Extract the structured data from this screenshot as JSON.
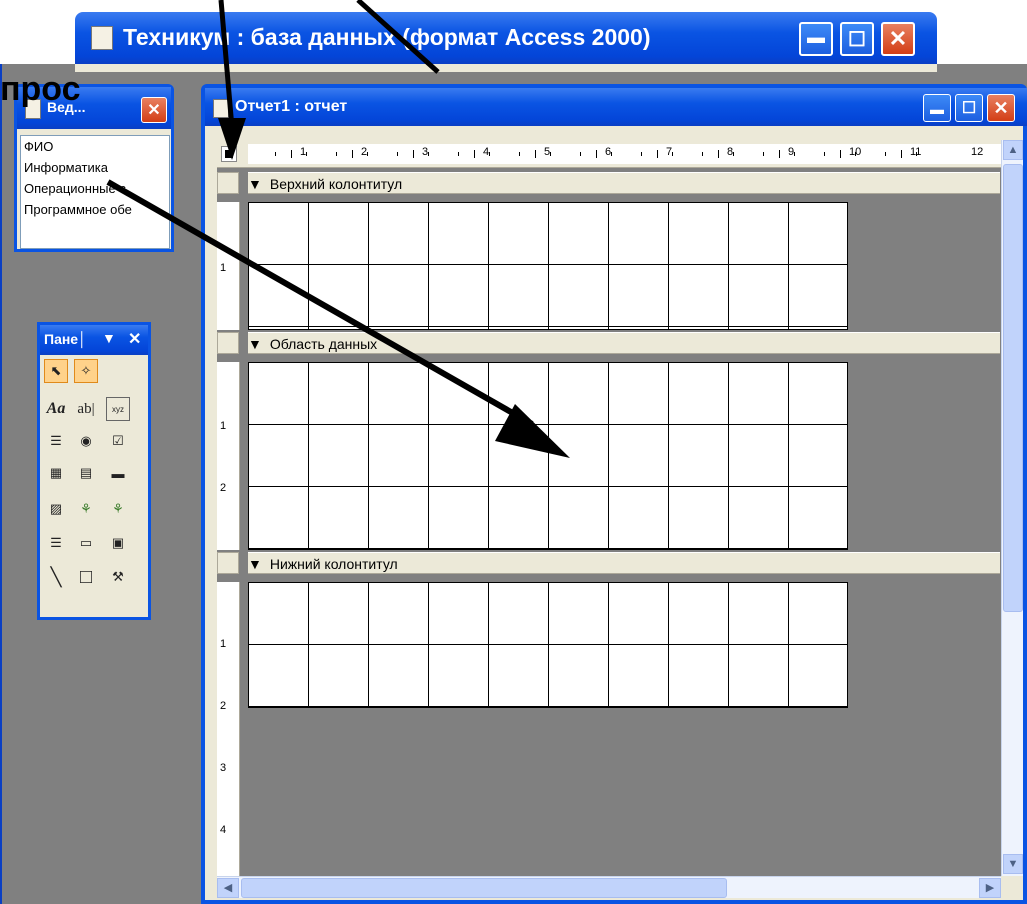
{
  "overlay": {
    "fragment": "прос"
  },
  "main_window": {
    "title": "Техникум : база данных (формат Access 2000)"
  },
  "field_list": {
    "title": "Вед...",
    "fields": [
      "ФИО",
      "Информатика",
      "Операционные с",
      "Программное обе"
    ]
  },
  "toolbox": {
    "title": "Пане│"
  },
  "report": {
    "title": "Отчет1 : отчет",
    "ruler_numbers": [
      "1",
      "2",
      "3",
      "4",
      "5",
      "6",
      "7",
      "8",
      "9",
      "10",
      "11",
      "12"
    ],
    "sections": {
      "header": "Верхний колонтитул",
      "detail": "Область данных",
      "footer": "Нижний колонтитул"
    },
    "vertical_ruler": {
      "header": [
        "1"
      ],
      "detail": [
        "1",
        "2"
      ],
      "footer": [
        "1",
        "2",
        "3",
        "4"
      ]
    }
  },
  "colors": {
    "xp_blue": "#0a54e3",
    "workspace_gray": "#808080",
    "arrow": "#000000"
  }
}
